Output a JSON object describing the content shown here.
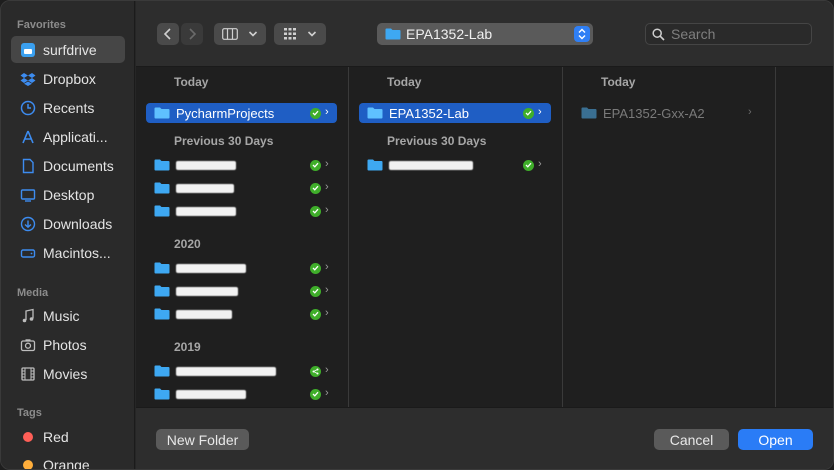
{
  "sidebar": {
    "favorites_header": "Favorites",
    "favorites": [
      {
        "label": "surfdrive",
        "icon": "surfdrive-icon",
        "active": true
      },
      {
        "label": "Dropbox",
        "icon": "dropbox-icon"
      },
      {
        "label": "Recents",
        "icon": "clock-icon"
      },
      {
        "label": "Applicati...",
        "icon": "applications-icon"
      },
      {
        "label": "Documents",
        "icon": "document-icon"
      },
      {
        "label": "Desktop",
        "icon": "desktop-icon"
      },
      {
        "label": "Downloads",
        "icon": "download-icon"
      },
      {
        "label": "Macintos...",
        "icon": "disk-icon"
      }
    ],
    "media_header": "Media",
    "media": [
      {
        "label": "Music",
        "icon": "music-icon"
      },
      {
        "label": "Photos",
        "icon": "camera-icon"
      },
      {
        "label": "Movies",
        "icon": "film-icon"
      }
    ],
    "tags_header": "Tags",
    "tags": [
      {
        "label": "Red",
        "color": "#ff5f57"
      },
      {
        "label": "Orange",
        "color": "#ffae3b"
      }
    ]
  },
  "toolbar": {
    "path_label": "EPA1352-Lab",
    "search_placeholder": "Search",
    "accent": "#2f7ff5"
  },
  "columns": [
    {
      "header": "Today",
      "selected": {
        "label": "PycharmProjects"
      },
      "sections": [
        {
          "header": "Previous 30 Days",
          "rows": 3
        },
        {
          "header": "2020",
          "rows": 3
        },
        {
          "header": "2019",
          "rows": 2
        }
      ]
    },
    {
      "header": "Today",
      "selected": {
        "label": "EPA1352-Lab"
      },
      "sections": [
        {
          "header": "Previous 30 Days",
          "rows": 1
        }
      ]
    },
    {
      "header": "Today",
      "item": {
        "label": "EPA1352-Gxx-A2"
      }
    }
  ],
  "buttons": {
    "new_folder": "New Folder",
    "cancel": "Cancel",
    "open": "Open"
  }
}
